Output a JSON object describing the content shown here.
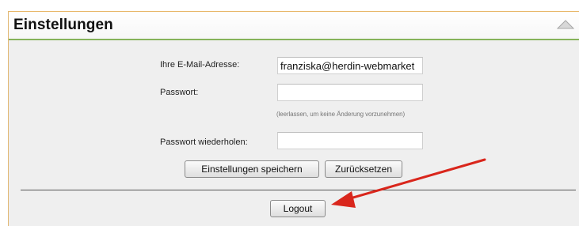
{
  "header": {
    "title": "Einstellungen",
    "collapse_icon": "collapse-up-triangle-icon"
  },
  "form": {
    "email_label": "Ihre E-Mail-Adresse:",
    "email_value": "franziska@herdin-webmarket",
    "password_label": "Passwort:",
    "password_value": "",
    "password_hint": "(leerlassen, um keine Änderung vorzunehmen)",
    "password_repeat_label": "Passwort wiederholen:",
    "password_repeat_value": ""
  },
  "buttons": {
    "save_label": "Einstellungen speichern",
    "reset_label": "Zurücksetzen",
    "logout_label": "Logout"
  },
  "annotation": {
    "arrow_icon": "red-arrow-pointing-to-logout",
    "arrow_color": "#d9261c"
  },
  "colors": {
    "panel_border": "#e8b86a",
    "header_underline": "#86b35a",
    "panel_background": "#efefef"
  }
}
